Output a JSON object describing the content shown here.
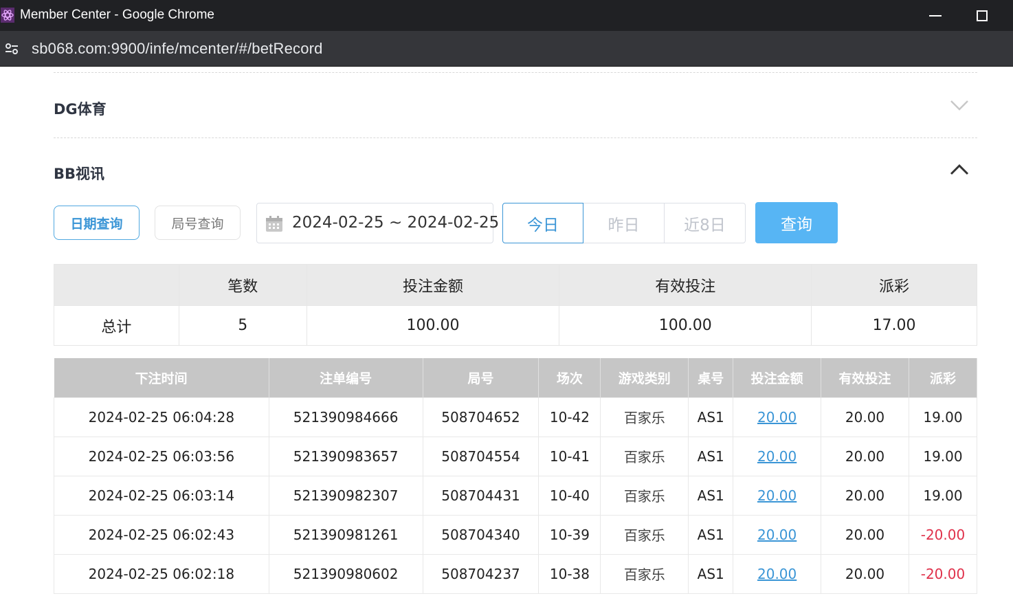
{
  "window": {
    "title": "Member Center - Google Chrome",
    "url": "sb068.com:9900/infe/mcenter/#/betRecord"
  },
  "sections": {
    "dg_title": "DG体育",
    "bb_title": "BB视讯"
  },
  "filters": {
    "tab_date": "日期查询",
    "tab_round": "局号查询",
    "date_range": "2024-02-25 ~ 2024-02-25",
    "today": "今日",
    "yesterday": "昨日",
    "last8": "近8日",
    "query": "查询"
  },
  "summary": {
    "headers": [
      "",
      "笔数",
      "投注金额",
      "有效投注",
      "派彩"
    ],
    "row": [
      "总计",
      "5",
      "100.00",
      "100.00",
      "17.00"
    ]
  },
  "records": {
    "headers": [
      "下注时间",
      "注单编号",
      "局号",
      "场次",
      "游戏类别",
      "桌号",
      "投注金额",
      "有效投注",
      "派彩"
    ],
    "rows": [
      [
        "2024-02-25 06:04:28",
        "521390984666",
        "508704652",
        "10-42",
        "百家乐",
        "AS1",
        "20.00",
        "20.00",
        "19.00"
      ],
      [
        "2024-02-25 06:03:56",
        "521390983657",
        "508704554",
        "10-41",
        "百家乐",
        "AS1",
        "20.00",
        "20.00",
        "19.00"
      ],
      [
        "2024-02-25 06:03:14",
        "521390982307",
        "508704431",
        "10-40",
        "百家乐",
        "AS1",
        "20.00",
        "20.00",
        "19.00"
      ],
      [
        "2024-02-25 06:02:43",
        "521390981261",
        "508704340",
        "10-39",
        "百家乐",
        "AS1",
        "20.00",
        "20.00",
        "-20.00"
      ],
      [
        "2024-02-25 06:02:18",
        "521390980602",
        "508704237",
        "10-38",
        "百家乐",
        "AS1",
        "20.00",
        "20.00",
        "-20.00"
      ]
    ]
  },
  "colors": {
    "accent": "#3a95d6",
    "query_button": "#57b5f4",
    "negative": "#e0314b",
    "header_gray": "#c6c6c6"
  },
  "icons": {
    "app": "atom-icon",
    "site_info": "tune-icon",
    "calendar": "calendar-icon",
    "expand": "chevron-down-icon",
    "collapse": "chevron-up-icon"
  }
}
